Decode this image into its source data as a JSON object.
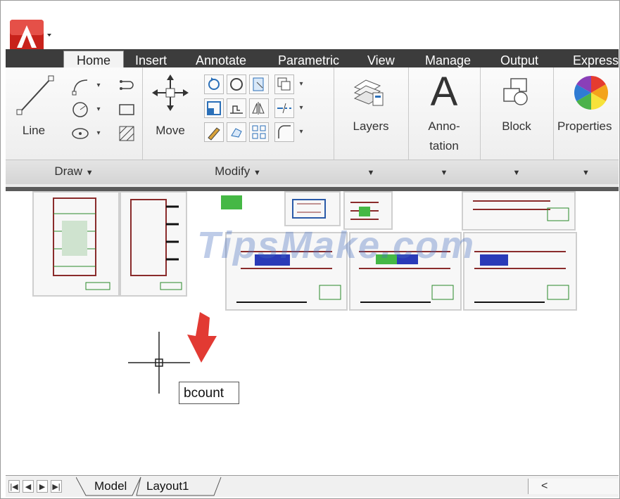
{
  "ribbon_tabs": [
    "Home",
    "Insert",
    "Annotate",
    "Parametric",
    "View",
    "Manage",
    "Output",
    "Express"
  ],
  "panels": {
    "draw": {
      "title": "Draw",
      "big_tool": "Line"
    },
    "modify": {
      "title": "Modify",
      "big_tool": "Move"
    },
    "layers": {
      "label": "Layers"
    },
    "annotation": {
      "label_line1": "Anno-",
      "label_line2": "tation",
      "glyph": "A"
    },
    "block": {
      "label": "Block"
    },
    "properties": {
      "label": "Properties"
    }
  },
  "panel_dropdown_glyph": "▼",
  "watermark": "TipsMake.com",
  "command_input": {
    "value": "bcount"
  },
  "layout_tabs": [
    "Model",
    "Layout1"
  ],
  "scroll_left_glyph": "<",
  "colors": {
    "tab_bar": "#3c3c3c",
    "accent_red": "#e23a33",
    "ribbon_bg": "#f0f0f0"
  }
}
